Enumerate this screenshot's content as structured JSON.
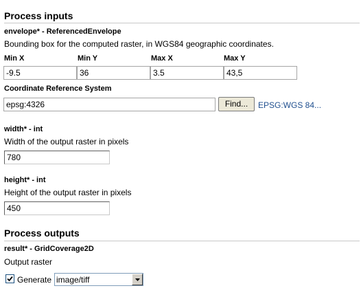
{
  "process_inputs": {
    "title": "Process inputs",
    "envelope": {
      "name": "envelope* - ReferencedEnvelope",
      "description": "Bounding box for the computed raster, in WGS84 geographic coordinates.",
      "fields": [
        {
          "label": "Min X",
          "value": "-9.5"
        },
        {
          "label": "Min Y",
          "value": "36"
        },
        {
          "label": "Max X",
          "value": "3.5"
        },
        {
          "label": "Max Y",
          "value": "43,5"
        }
      ],
      "crs": {
        "label": "Coordinate Reference System",
        "value": "epsg:4326",
        "find_button": "Find...",
        "resolved": "EPSG:WGS 84..."
      }
    },
    "width": {
      "name": "width* - int",
      "description": "Width of the output raster in pixels",
      "value": "780"
    },
    "height": {
      "name": "height* - int",
      "description": "Height of the output raster in pixels",
      "value": "450"
    }
  },
  "process_outputs": {
    "title": "Process outputs",
    "result": {
      "name": "result* - GridCoverage2D",
      "description": "Output raster",
      "generate_label": "Generate",
      "generate_checked": true,
      "format": "image/tiff"
    }
  },
  "colors": {
    "link": "#1f4f8f",
    "rule": "#c8c8c8",
    "button_face": "#ece9d8",
    "checkbox_border": "#1c5180",
    "select_border": "#7f9db9"
  },
  "icons": {
    "checkbox": "checkmark-icon",
    "dropdown": "chevron-down-icon"
  }
}
